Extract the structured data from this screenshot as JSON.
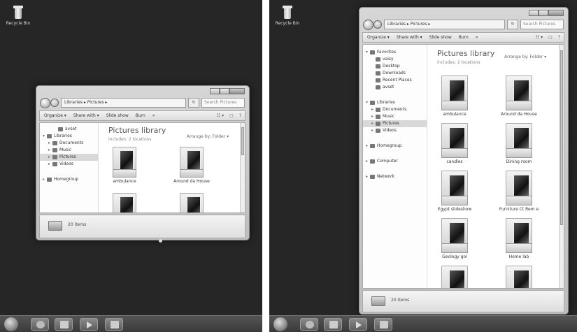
{
  "desktop": {
    "recycle_bin_label": "Recycle Bin"
  },
  "explorer": {
    "address_path": "Libraries ▸ Pictures ▸",
    "search_placeholder": "Search Pictures",
    "refresh_symbol": "↻",
    "toolbar": {
      "organize": "Organize ▾",
      "share_with": "Share with ▾",
      "slide_show": "Slide show",
      "burn": "Burn",
      "more": "»",
      "view": "☷ ▾",
      "preview": "▢",
      "help": "?"
    },
    "library_title": "Pictures library",
    "library_subtitle": "Includes: 2 locations",
    "arrange_by": "Arrange by:  Folder ▾",
    "item_count": "20 items"
  },
  "left_window": {
    "nav_items": [
      {
        "label": "avset",
        "indent": 2,
        "selected": false
      },
      {
        "label": "Libraries",
        "indent": 0,
        "selected": false,
        "expander": "▾"
      },
      {
        "label": "Documents",
        "indent": 1,
        "selected": false,
        "expander": "▸"
      },
      {
        "label": "Music",
        "indent": 1,
        "selected": false,
        "expander": "▸"
      },
      {
        "label": "Pictures",
        "indent": 1,
        "selected": true,
        "expander": "▸"
      },
      {
        "label": "Videos",
        "indent": 1,
        "selected": false,
        "expander": "▸"
      },
      {
        "label": "Homegroup",
        "indent": 0,
        "selected": false,
        "expander": "▸",
        "gap_before": true
      }
    ],
    "folders": [
      "ambulance",
      "Around da House",
      "",
      ""
    ]
  },
  "right_window": {
    "nav_items": [
      {
        "label": "Favorites",
        "indent": 0,
        "selected": false,
        "expander": "▾"
      },
      {
        "label": "vaisy",
        "indent": 1,
        "selected": false
      },
      {
        "label": "Desktop",
        "indent": 1,
        "selected": false
      },
      {
        "label": "Downloads",
        "indent": 1,
        "selected": false
      },
      {
        "label": "Recent Places",
        "indent": 1,
        "selected": false
      },
      {
        "label": "avset",
        "indent": 1,
        "selected": false
      },
      {
        "label": "Libraries",
        "indent": 0,
        "selected": false,
        "expander": "▾",
        "gap_before": true
      },
      {
        "label": "Documents",
        "indent": 1,
        "selected": false,
        "expander": "▸"
      },
      {
        "label": "Music",
        "indent": 1,
        "selected": false,
        "expander": "▸"
      },
      {
        "label": "Pictures",
        "indent": 1,
        "selected": true,
        "expander": "▸"
      },
      {
        "label": "Videos",
        "indent": 1,
        "selected": false,
        "expander": "▸"
      },
      {
        "label": "Homegroup",
        "indent": 0,
        "selected": false,
        "expander": "▸",
        "gap_before": true
      },
      {
        "label": "Computer",
        "indent": 0,
        "selected": false,
        "expander": "▸",
        "gap_before": true
      },
      {
        "label": "Network",
        "indent": 0,
        "selected": false,
        "expander": "▸",
        "gap_before": true
      }
    ],
    "folders": [
      "ambulance",
      "Around da House",
      "candles",
      "Dining room",
      "Egypt slideshow",
      "Furniture Ct Rem e",
      "Geology gol",
      "Home lab",
      "",
      ""
    ]
  }
}
